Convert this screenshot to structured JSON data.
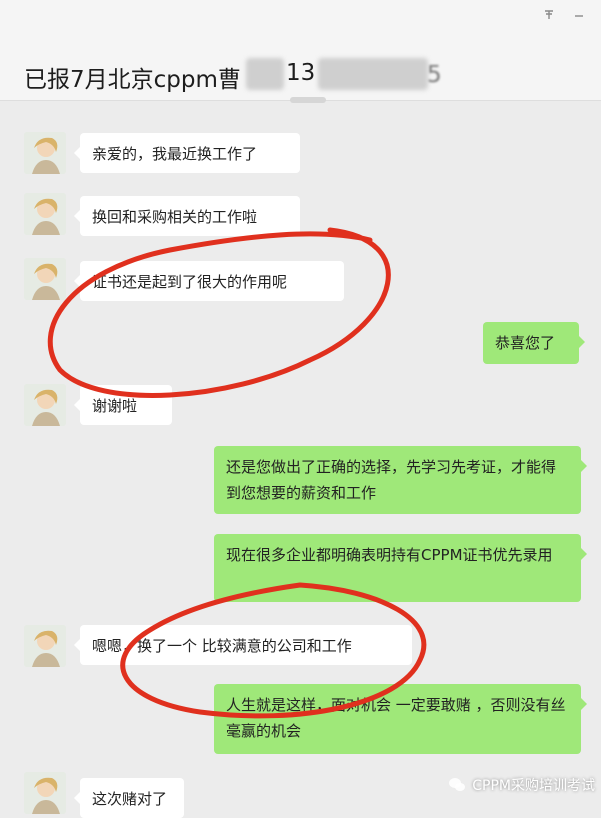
{
  "window": {
    "pin_icon": "pin-icon",
    "minimize_icon": "minimize-icon"
  },
  "chat": {
    "title": "已报7月北京cppm曹",
    "title_digits": "13"
  },
  "messages": [
    {
      "side": "in",
      "text": "亲爱的，我最近换工作了"
    },
    {
      "side": "in",
      "text": "换回和采购相关的工作啦"
    },
    {
      "side": "in",
      "text": "证书还是起到了很大的作用呢"
    },
    {
      "side": "out",
      "text": "恭喜您了"
    },
    {
      "side": "in",
      "text": "谢谢啦"
    },
    {
      "side": "out",
      "text": "还是您做出了正确的选择，先学习先考证，才能得到您想要的薪资和工作"
    },
    {
      "side": "out",
      "text": "现在很多企业都明确表明持有CPPM证书优先录用"
    },
    {
      "side": "in",
      "text": "嗯嗯，换了一个 比较满意的公司和工作"
    },
    {
      "side": "out",
      "text": "人生就是这样，面对机会 一定要敢赌 ，否则没有丝毫赢的机会"
    },
    {
      "side": "in",
      "text": "这次赌对了"
    }
  ],
  "annotations": {
    "color": "#e0301e"
  },
  "watermark": {
    "text": "CPPM采购培训考试",
    "icon": "wechat-icon"
  }
}
